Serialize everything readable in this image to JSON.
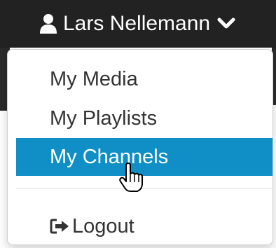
{
  "navbar": {
    "user_name": "Lars Nellemann",
    "user_icon": "user-icon",
    "chevron_icon": "chevron-down-icon"
  },
  "dropdown": {
    "items": [
      {
        "label": "My Media"
      },
      {
        "label": "My Playlists"
      },
      {
        "label": "My Channels",
        "active": true
      }
    ],
    "logout": {
      "label": "Logout",
      "icon": "sign-out-icon"
    }
  },
  "colors": {
    "navbar_bg": "#222222",
    "active_item_bg": "#0f8fc6",
    "text": "#333333"
  }
}
